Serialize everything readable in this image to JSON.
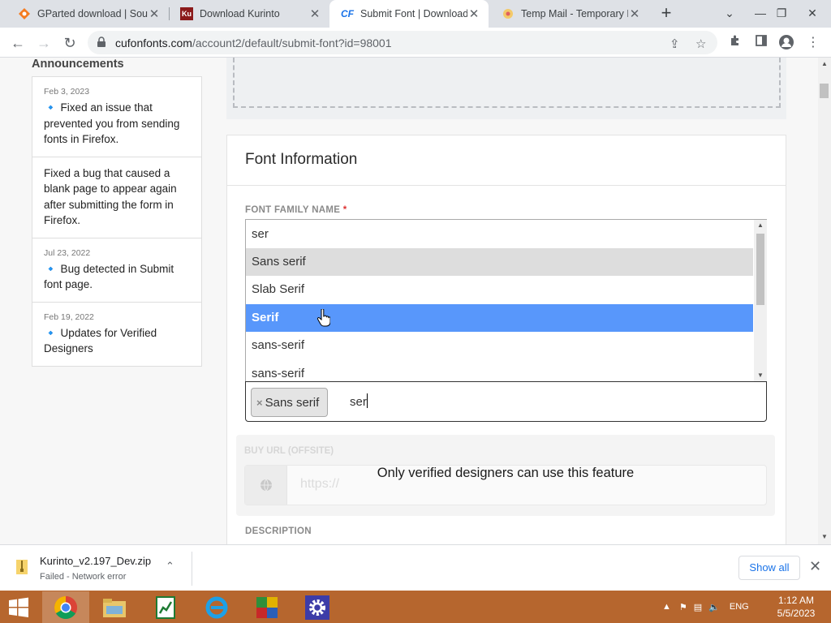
{
  "browser": {
    "tabs": [
      {
        "title": "GParted download | Sour",
        "favicon": "gparted-icon",
        "active": false
      },
      {
        "title": "Download Kurinto",
        "favicon": "kurinto-icon",
        "active": false
      },
      {
        "title": "Submit Font | Download",
        "favicon": "cufonfonts-icon",
        "active": true
      },
      {
        "title": "Temp Mail - Temporary D",
        "favicon": "tempmail-icon",
        "active": false
      }
    ],
    "url_host": "cufonfonts.com",
    "url_path": "/account2/default/submit-font?id=98001"
  },
  "sidebar": {
    "title": "Announcements",
    "items": [
      {
        "date": "Feb 3, 2023",
        "text": "🔹 Fixed an issue that prevented you from sending fonts in Firefox."
      },
      {
        "date": "",
        "text": "Fixed a bug that caused a blank page to appear again after submitting the form in Firefox."
      },
      {
        "date": "Jul 23, 2022",
        "text": "🔹 Bug detected in Submit font page."
      },
      {
        "date": "Feb 19, 2022",
        "text": "🔹 Updates for Verified Designers"
      }
    ]
  },
  "form": {
    "section_title": "Font Information",
    "family_label": "FONT FAMILY NAME",
    "required_mark": "*",
    "dropdown": {
      "search_value": "ser",
      "options": [
        "Sans serif",
        "Slab Serif",
        "Serif",
        "sans-serif",
        "sans-serif"
      ],
      "highlighted_index": 0,
      "selected_index": 2
    },
    "selected_tag": "Sans serif",
    "tag_remove": "×",
    "tag_input_value": "ser",
    "buy_url_label": "BUY URL (OFFSITE)",
    "buy_url_placeholder": "https://",
    "locked_message": "Only verified designers can use this feature",
    "description_label": "DESCRIPTION"
  },
  "download_bar": {
    "filename": "Kurinto_v2.197_Dev.zip",
    "status": "Failed - Network error",
    "show_all": "Show all"
  },
  "taskbar": {
    "language": "ENG",
    "time": "1:12 AM",
    "date": "5/5/2023"
  }
}
